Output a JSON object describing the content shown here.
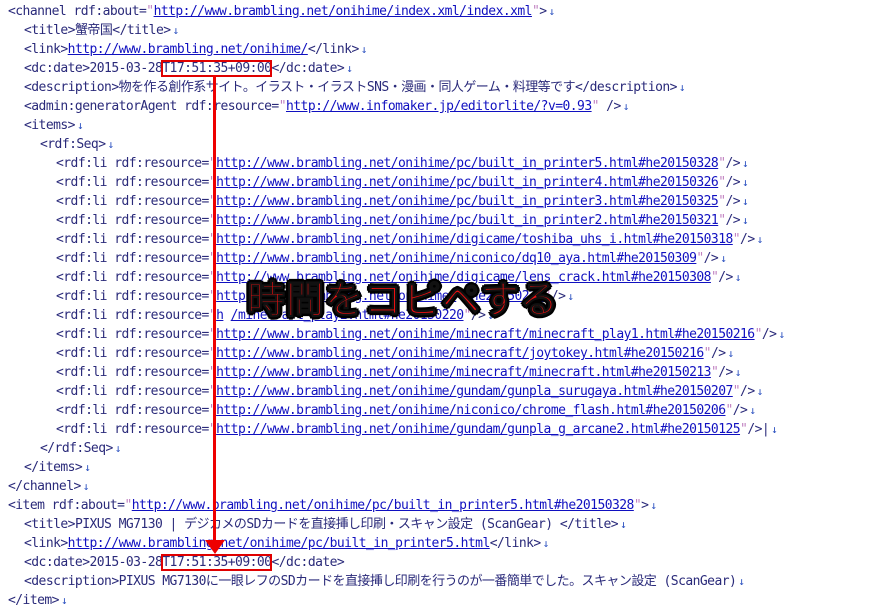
{
  "lines": [
    {
      "indent": 8,
      "parts": [
        [
          "tag",
          "<channel "
        ],
        [
          "attr",
          "rdf:about="
        ],
        [
          "q",
          "\""
        ],
        [
          "url",
          "http://www.brambling.net/onihime/index.xml/index.xml"
        ],
        [
          "q",
          "\""
        ],
        [
          "tag",
          ">"
        ]
      ]
    },
    {
      "indent": 24,
      "parts": [
        [
          "tag",
          "<title>"
        ],
        [
          "val",
          "蟹帝国"
        ],
        [
          "tag",
          "</title>"
        ]
      ]
    },
    {
      "indent": 24,
      "parts": [
        [
          "tag",
          "<link>"
        ],
        [
          "url",
          "http://www.brambling.net/onihime/"
        ],
        [
          "tag",
          "</link>"
        ]
      ]
    },
    {
      "indent": 24,
      "parts": [
        [
          "tag",
          "<dc:date>"
        ],
        [
          "val",
          "2015-03-28"
        ],
        [
          "hl",
          "T17:51:35+09:00"
        ],
        [
          "tag",
          "</dc:date>"
        ]
      ]
    },
    {
      "indent": 24,
      "parts": [
        [
          "tag",
          "<description>"
        ],
        [
          "val",
          "物を作る創作系サイト。イラスト・イラストSNS・漫画・同人ゲーム・料理等です"
        ],
        [
          "tag",
          "</description>"
        ]
      ]
    },
    {
      "indent": 24,
      "parts": [
        [
          "tag",
          "<admin:generatorAgent "
        ],
        [
          "attr",
          "rdf:resource="
        ],
        [
          "q",
          "\""
        ],
        [
          "url",
          "http://www.infomaker.jp/editorlite/?v=0.93"
        ],
        [
          "q",
          "\""
        ],
        [
          "tag",
          " />"
        ]
      ]
    },
    {
      "indent": 24,
      "parts": [
        [
          "tag",
          "<items>"
        ]
      ]
    },
    {
      "indent": 40,
      "parts": [
        [
          "tag",
          "<rdf:Seq>"
        ]
      ]
    },
    {
      "indent": 56,
      "parts": [
        [
          "tag",
          "<rdf:li "
        ],
        [
          "attr",
          "rdf:resource="
        ],
        [
          "q",
          "\""
        ],
        [
          "url",
          "http://www.brambling.net/onihime/pc/built_in_printer5.html#he20150328"
        ],
        [
          "q",
          "\""
        ],
        [
          "tag",
          "/>"
        ]
      ]
    },
    {
      "indent": 56,
      "parts": [
        [
          "tag",
          "<rdf:li "
        ],
        [
          "attr",
          "rdf:resource="
        ],
        [
          "q",
          "\""
        ],
        [
          "url",
          "http://www.brambling.net/onihime/pc/built_in_printer4.html#he20150326"
        ],
        [
          "q",
          "\""
        ],
        [
          "tag",
          "/>"
        ]
      ]
    },
    {
      "indent": 56,
      "parts": [
        [
          "tag",
          "<rdf:li "
        ],
        [
          "attr",
          "rdf:resource="
        ],
        [
          "q",
          "\""
        ],
        [
          "url",
          "http://www.brambling.net/onihime/pc/built_in_printer3.html#he20150325"
        ],
        [
          "q",
          "\""
        ],
        [
          "tag",
          "/>"
        ]
      ]
    },
    {
      "indent": 56,
      "parts": [
        [
          "tag",
          "<rdf:li "
        ],
        [
          "attr",
          "rdf:resource="
        ],
        [
          "q",
          "\""
        ],
        [
          "url",
          "http://www.brambling.net/onihime/pc/built_in_printer2.html#he20150321"
        ],
        [
          "q",
          "\""
        ],
        [
          "tag",
          "/>"
        ]
      ]
    },
    {
      "indent": 56,
      "parts": [
        [
          "tag",
          "<rdf:li "
        ],
        [
          "attr",
          "rdf:resource="
        ],
        [
          "q",
          "\""
        ],
        [
          "url",
          "http://www.brambling.net/onihime/digicame/toshiba_uhs_i.html#he20150318"
        ],
        [
          "q",
          "\""
        ],
        [
          "tag",
          "/>"
        ]
      ]
    },
    {
      "indent": 56,
      "parts": [
        [
          "tag",
          "<rdf:li "
        ],
        [
          "attr",
          "rdf:resource="
        ],
        [
          "q",
          "\""
        ],
        [
          "url",
          "http://www.brambling.net/onihime/niconico/dq10_aya.html#he20150309"
        ],
        [
          "q",
          "\""
        ],
        [
          "tag",
          "/>"
        ]
      ]
    },
    {
      "indent": 56,
      "parts": [
        [
          "tag",
          "<rdf:li "
        ],
        [
          "attr",
          "rdf:resource="
        ],
        [
          "q",
          "\""
        ],
        [
          "url",
          "http://www.brambling.net/onihime/digicame/lens_crack.html#he20150308"
        ],
        [
          "q",
          "\""
        ],
        [
          "tag",
          "/>"
        ]
      ]
    },
    {
      "indent": 56,
      "parts": [
        [
          "tag",
          "<rdf:li "
        ],
        [
          "attr",
          "rdf:resource="
        ],
        [
          "q",
          "\""
        ],
        [
          "url",
          "http://www.brambling.net/onihime/"
        ],
        [
          "val",
          "                          "
        ],
        [
          "url",
          "#he20150227"
        ],
        [
          "q",
          "\""
        ],
        [
          "tag",
          "/>"
        ]
      ]
    },
    {
      "indent": 56,
      "parts": [
        [
          "tag",
          "<rdf:li "
        ],
        [
          "attr",
          "rdf:resource="
        ],
        [
          "q",
          "\""
        ],
        [
          "url",
          "h"
        ],
        [
          "val",
          "                          "
        ],
        [
          "url",
          "/minecraft_play2.html#he20150220"
        ],
        [
          "q",
          "\""
        ],
        [
          "tag",
          "/>"
        ]
      ]
    },
    {
      "indent": 56,
      "parts": [
        [
          "tag",
          "<rdf:li "
        ],
        [
          "attr",
          "rdf:resource="
        ],
        [
          "q",
          "\""
        ],
        [
          "url",
          "http://www.brambling.net/onihime/minecraft/minecraft_play1.html#he20150216"
        ],
        [
          "q",
          "\""
        ],
        [
          "tag",
          "/>"
        ]
      ]
    },
    {
      "indent": 56,
      "parts": [
        [
          "tag",
          "<rdf:li "
        ],
        [
          "attr",
          "rdf:resource="
        ],
        [
          "q",
          "\""
        ],
        [
          "url",
          "http://www.brambling.net/onihime/minecraft/joytokey.html#he20150216"
        ],
        [
          "q",
          "\""
        ],
        [
          "tag",
          "/>"
        ]
      ]
    },
    {
      "indent": 56,
      "parts": [
        [
          "tag",
          "<rdf:li "
        ],
        [
          "attr",
          "rdf:resource="
        ],
        [
          "q",
          "\""
        ],
        [
          "url",
          "http://www.brambling.net/onihime/minecraft/minecraft.html#he20150213"
        ],
        [
          "q",
          "\""
        ],
        [
          "tag",
          "/>"
        ]
      ]
    },
    {
      "indent": 56,
      "parts": [
        [
          "tag",
          "<rdf:li "
        ],
        [
          "attr",
          "rdf:resource="
        ],
        [
          "q",
          "\""
        ],
        [
          "url",
          "http://www.brambling.net/onihime/gundam/gunpla_surugaya.html#he20150207"
        ],
        [
          "q",
          "\""
        ],
        [
          "tag",
          "/>"
        ]
      ]
    },
    {
      "indent": 56,
      "parts": [
        [
          "tag",
          "<rdf:li "
        ],
        [
          "attr",
          "rdf:resource="
        ],
        [
          "q",
          "\""
        ],
        [
          "url",
          "http://www.brambling.net/onihime/niconico/chrome_flash.html#he20150206"
        ],
        [
          "q",
          "\""
        ],
        [
          "tag",
          "/>"
        ]
      ]
    },
    {
      "indent": 56,
      "parts": [
        [
          "tag",
          "<rdf:li "
        ],
        [
          "attr",
          "rdf:resource="
        ],
        [
          "q",
          "\""
        ],
        [
          "url",
          "http://www.brambling.net/onihime/gundam/gunpla_g_arcane2.html#he20150125"
        ],
        [
          "q",
          "\""
        ],
        [
          "tag",
          "/>|"
        ]
      ]
    },
    {
      "indent": 40,
      "parts": [
        [
          "tag",
          "</rdf:Seq>"
        ]
      ]
    },
    {
      "indent": 24,
      "parts": [
        [
          "tag",
          "</items>"
        ]
      ]
    },
    {
      "indent": 8,
      "parts": [
        [
          "tag",
          "</channel>"
        ]
      ]
    },
    {
      "indent": 8,
      "parts": [
        [
          "tag",
          "<item "
        ],
        [
          "attr",
          "rdf:about="
        ],
        [
          "q",
          "\""
        ],
        [
          "url",
          "http://www.brambling.net/onihime/pc/built_in_printer5.html#he20150328"
        ],
        [
          "q",
          "\""
        ],
        [
          "tag",
          ">"
        ]
      ]
    },
    {
      "indent": 24,
      "parts": [
        [
          "tag",
          "<title>"
        ],
        [
          "val",
          "PIXUS MG7130 | デジカメのSDカードを直接挿し印刷・スキャン設定 (ScanGear) "
        ],
        [
          "tag",
          "</title>"
        ]
      ]
    },
    {
      "indent": 24,
      "parts": [
        [
          "tag",
          "<link>"
        ],
        [
          "url",
          "http://www.brambling.net/onihime/pc/built_in_printer5.html"
        ],
        [
          "tag",
          "</link>"
        ]
      ]
    },
    {
      "indent": 24,
      "parts": [
        [
          "tag",
          "<dc:date>"
        ],
        [
          "val",
          "2015-03-28"
        ],
        [
          "hl",
          "T17:51:35+09:00"
        ],
        [
          "tag",
          "</dc:date>"
        ]
      ]
    },
    {
      "indent": 24,
      "parts": [
        [
          "tag",
          "<description>"
        ],
        [
          "val",
          "PIXUS MG7130に一眼レフのSDカードを直接挿し印刷を行うのが一番簡単でした。スキャン設定 (ScanGear)"
        ]
      ]
    },
    {
      "indent": 8,
      "parts": [
        [
          "tag",
          "</item>"
        ]
      ]
    }
  ],
  "eol_mark": "↓",
  "overlay": {
    "text": "時間をコピペする"
  }
}
